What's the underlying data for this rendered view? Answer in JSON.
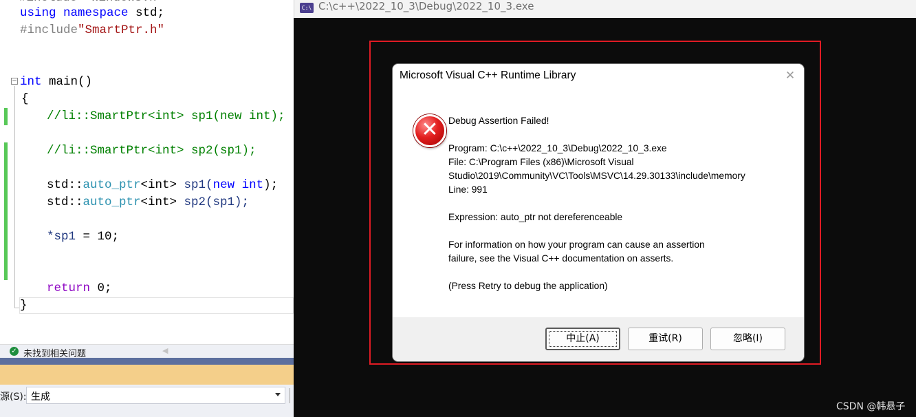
{
  "editor": {
    "line0": "#include <windows.h>",
    "using_kw": "using",
    "namespace_kw": "namespace",
    "using_rest": " std;",
    "include_pp": "#include",
    "include_file": "\"SmartPtr.h\"",
    "int_kw": "int",
    "main_sig": " main()",
    "open_brace": "{",
    "comment1": "//li::SmartPtr<int> sp1(new int);",
    "comment2": "//li::SmartPtr<int> sp2(sp1);",
    "std_ns": "std::",
    "auto_ptr": "auto_ptr",
    "lt_int_gt_1": "<int>",
    "sp1_decl": " sp1(",
    "new_kw": "new",
    "int_kw2": " int",
    "close_stmt1": ");",
    "lt_int_gt_2": "<int>",
    "sp2_decl": " sp2(sp1);",
    "deref": "*sp1",
    "assign": " = 10;",
    "return_kw": "return",
    "return_rest": " 0;",
    "close_brace": "}"
  },
  "status": {
    "issues_text": "未找到相关问题"
  },
  "output": {
    "source_label": "源(S):",
    "source_value": "生成"
  },
  "console": {
    "icon_text": "C:\\",
    "title": "C:\\c++\\2022_10_3\\Debug\\2022_10_3.exe"
  },
  "dialog": {
    "title": "Microsoft Visual C++ Runtime Library",
    "close_glyph": "✕",
    "heading": "Debug Assertion Failed!",
    "program": "Program: C:\\c++\\2022_10_3\\Debug\\2022_10_3.exe",
    "file_line1": "File: C:\\Program Files (x86)\\Microsoft Visual",
    "file_line2": "Studio\\2019\\Community\\VC\\Tools\\MSVC\\14.29.30133\\include\\memory",
    "line": "Line: 991",
    "expression": "Expression: auto_ptr not dereferenceable",
    "info1": "For information on how your program can cause an assertion",
    "info2": "failure, see the Visual C++ documentation on asserts.",
    "press_retry": "(Press Retry to debug the application)",
    "buttons": {
      "abort": "中止(A)",
      "retry": "重试(R)",
      "ignore": "忽略(I)"
    }
  },
  "watermark": "CSDN @韩悬子",
  "colors": {
    "editor_bg": "#ffffff",
    "console_bg": "#0c0c0c",
    "highlight_frame": "#e01b24",
    "output_title_bar": "#f4cf8a",
    "separator_bar": "#5c6f9e"
  }
}
